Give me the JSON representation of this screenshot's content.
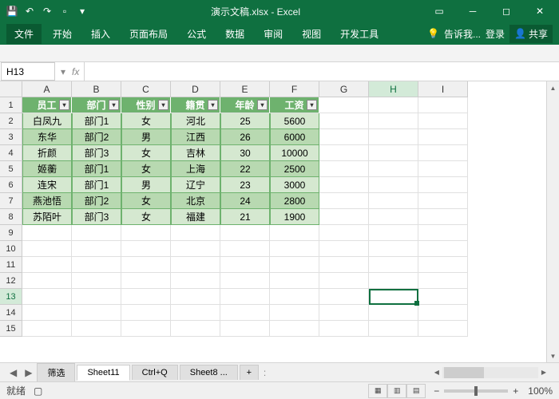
{
  "title": "演示文稿.xlsx - Excel",
  "ribbon": {
    "file": "文件",
    "tabs": [
      "开始",
      "插入",
      "页面布局",
      "公式",
      "数据",
      "审阅",
      "视图",
      "开发工具"
    ],
    "tell": "告诉我...",
    "login": "登录",
    "share": "共享"
  },
  "namebox": "H13",
  "fx_label": "fx",
  "columns": [
    "A",
    "B",
    "C",
    "D",
    "E",
    "F",
    "G",
    "H",
    "I"
  ],
  "rows": [
    "1",
    "2",
    "3",
    "4",
    "5",
    "6",
    "7",
    "8",
    "9",
    "10",
    "11",
    "12",
    "13",
    "14",
    "15"
  ],
  "headers": [
    "员工",
    "部门",
    "性别",
    "籍贯",
    "年龄",
    "工资"
  ],
  "data": [
    [
      "白凤九",
      "部门1",
      "女",
      "河北",
      "25",
      "5600"
    ],
    [
      "东华",
      "部门2",
      "男",
      "江西",
      "26",
      "6000"
    ],
    [
      "折颜",
      "部门3",
      "女",
      "吉林",
      "30",
      "10000"
    ],
    [
      "姬蘅",
      "部门1",
      "女",
      "上海",
      "22",
      "2500"
    ],
    [
      "连宋",
      "部门1",
      "男",
      "辽宁",
      "23",
      "3000"
    ],
    [
      "燕池悟",
      "部门2",
      "女",
      "北京",
      "24",
      "2800"
    ],
    [
      "苏陌叶",
      "部门3",
      "女",
      "福建",
      "21",
      "1900"
    ]
  ],
  "sheets": [
    "筛选",
    "Sheet11",
    "Ctrl+Q",
    "Sheet8  ..."
  ],
  "active_sheet": 1,
  "plus": "+",
  "status": {
    "ready": "就绪",
    "calc": "",
    "zoom": "100%"
  },
  "selected_col": "H",
  "selected_row": "13"
}
